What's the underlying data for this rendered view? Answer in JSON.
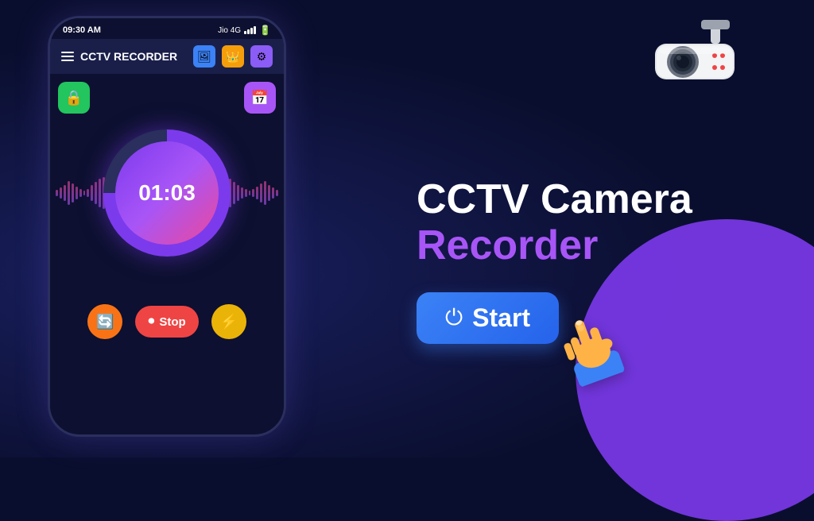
{
  "app": {
    "title": "CCTV RECORDER",
    "status_bar": {
      "time": "09:30 AM",
      "carrier": "Jio 4G"
    }
  },
  "phone": {
    "timer": "01:03",
    "controls": {
      "stop_label": "Stop"
    }
  },
  "headline": {
    "line1": "CCTV Camera",
    "line2": "Recorder"
  },
  "start_button": {
    "label": "Start"
  },
  "icons": {
    "hamburger": "☰",
    "gallery": "🖼",
    "crown": "👑",
    "settings": "⚙",
    "camera_lock": "🔒",
    "rotate": "🔄",
    "lightning": "⚡",
    "record_dot": "⏺",
    "power": "⏻"
  }
}
